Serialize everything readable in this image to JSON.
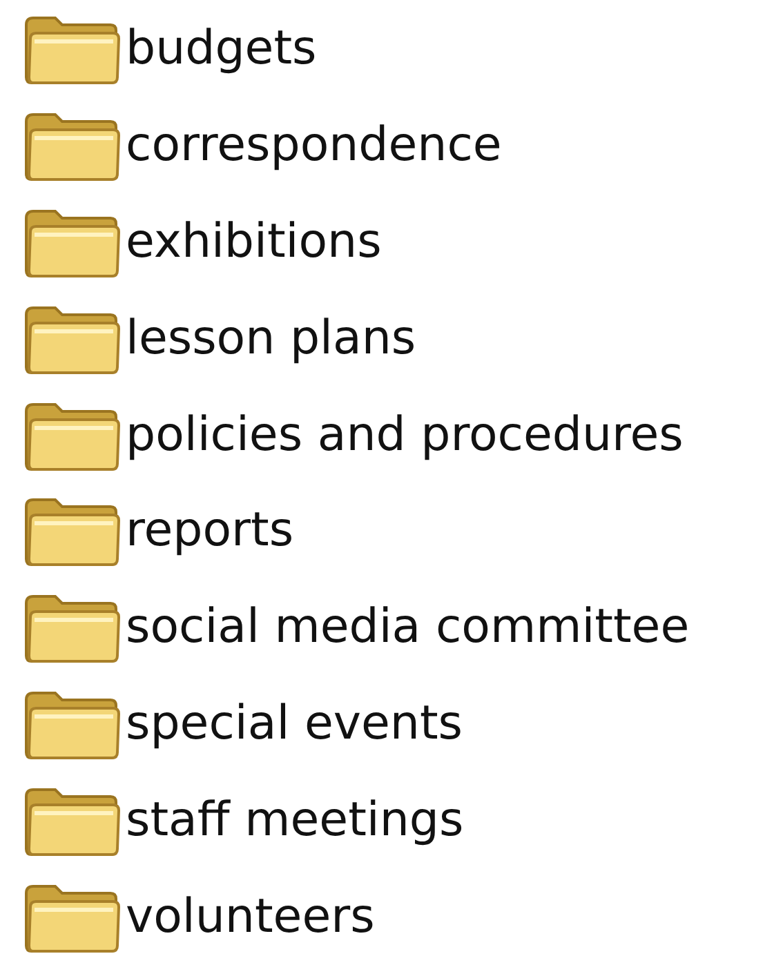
{
  "folders": [
    {
      "name": "budgets"
    },
    {
      "name": "correspondence"
    },
    {
      "name": "exhibitions"
    },
    {
      "name": "lesson plans"
    },
    {
      "name": "policies and procedures"
    },
    {
      "name": "reports"
    },
    {
      "name": "social media committee"
    },
    {
      "name": "special events"
    },
    {
      "name": "staff meetings"
    },
    {
      "name": "volunteers"
    }
  ]
}
